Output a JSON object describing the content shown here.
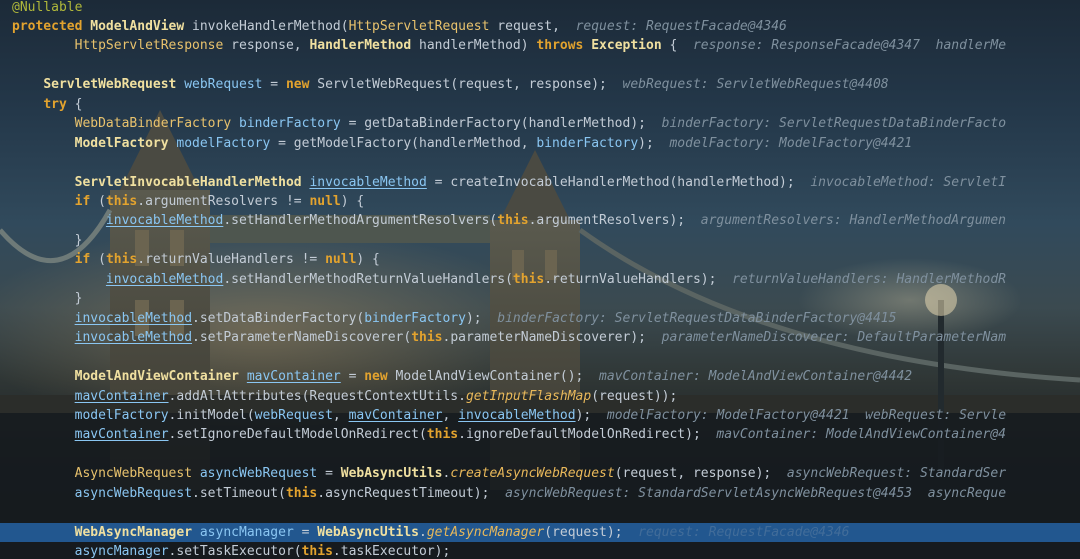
{
  "colors": {
    "keyword": "#e3a32e",
    "annotation": "#b0b83a",
    "type": "#e8c26d",
    "method": "#f7c66b",
    "variable": "#8ac6f2",
    "field": "#d6a4e8",
    "hint": "#7f909e",
    "current_line": "#22578f"
  },
  "code_lines": [
    {
      "tokens": [
        {
          "t": "@Nullable",
          "c": "an"
        }
      ]
    },
    {
      "tokens": [
        {
          "t": "protected ",
          "c": "kw"
        },
        {
          "t": "ModelAndView",
          "c": "tyb"
        },
        {
          "t": " invokeHandlerMethod(",
          "c": "pl"
        },
        {
          "t": "HttpServletRequest",
          "c": "ty"
        },
        {
          "t": " request,  ",
          "c": "pl"
        },
        {
          "t": "request: RequestFacade@4346",
          "c": "hint"
        }
      ]
    },
    {
      "tokens": [
        {
          "t": "        ",
          "c": "pl"
        },
        {
          "t": "HttpServletResponse",
          "c": "ty"
        },
        {
          "t": " response, ",
          "c": "pl"
        },
        {
          "t": "HandlerMethod",
          "c": "tyb"
        },
        {
          "t": " handlerMethod) ",
          "c": "pl"
        },
        {
          "t": "throws ",
          "c": "kw"
        },
        {
          "t": "Exception",
          "c": "tyb"
        },
        {
          "t": " {  ",
          "c": "pl"
        },
        {
          "t": "response: ResponseFacade@4347  handlerMe",
          "c": "hint"
        }
      ]
    },
    {
      "tokens": []
    },
    {
      "tokens": [
        {
          "t": "    ",
          "c": "pl"
        },
        {
          "t": "ServletWebRequest",
          "c": "tyb"
        },
        {
          "t": " ",
          "c": "pl"
        },
        {
          "t": "webRequest",
          "c": "lv"
        },
        {
          "t": " = ",
          "c": "pl"
        },
        {
          "t": "new ",
          "c": "kw"
        },
        {
          "t": "ServletWebRequest(request, response);  ",
          "c": "pl"
        },
        {
          "t": "webRequest: ServletWebRequest@4408",
          "c": "hint"
        }
      ]
    },
    {
      "tokens": [
        {
          "t": "    ",
          "c": "pl"
        },
        {
          "t": "try",
          "c": "kw"
        },
        {
          "t": " {",
          "c": "pl"
        }
      ]
    },
    {
      "tokens": [
        {
          "t": "        ",
          "c": "pl"
        },
        {
          "t": "WebDataBinderFactory",
          "c": "ty"
        },
        {
          "t": " ",
          "c": "pl"
        },
        {
          "t": "binderFactory",
          "c": "lv"
        },
        {
          "t": " = getDataBinderFactory(handlerMethod);  ",
          "c": "pl"
        },
        {
          "t": "binderFactory: ServletRequestDataBinderFacto",
          "c": "hint"
        }
      ]
    },
    {
      "tokens": [
        {
          "t": "        ",
          "c": "pl"
        },
        {
          "t": "ModelFactory",
          "c": "tyb"
        },
        {
          "t": " ",
          "c": "pl"
        },
        {
          "t": "modelFactory",
          "c": "lv"
        },
        {
          "t": " = getModelFactory(handlerMethod, ",
          "c": "pl"
        },
        {
          "t": "binderFactory",
          "c": "lv"
        },
        {
          "t": ");  ",
          "c": "pl"
        },
        {
          "t": "modelFactory: ModelFactory@4421",
          "c": "hint"
        }
      ]
    },
    {
      "tokens": []
    },
    {
      "tokens": [
        {
          "t": "        ",
          "c": "pl"
        },
        {
          "t": "ServletInvocableHandlerMethod",
          "c": "tyb"
        },
        {
          "t": " ",
          "c": "pl"
        },
        {
          "t": "invocableMethod",
          "c": "lvu"
        },
        {
          "t": " = createInvocableHandlerMethod(handlerMethod);  ",
          "c": "pl"
        },
        {
          "t": "invocableMethod: ServletI",
          "c": "hint"
        }
      ]
    },
    {
      "tokens": [
        {
          "t": "        ",
          "c": "pl"
        },
        {
          "t": "if",
          "c": "kw"
        },
        {
          "t": " (",
          "c": "pl"
        },
        {
          "t": "this",
          "c": "kw"
        },
        {
          "t": ".argumentResolvers != ",
          "c": "pl"
        },
        {
          "t": "null",
          "c": "kw"
        },
        {
          "t": ") {",
          "c": "pl"
        }
      ]
    },
    {
      "tokens": [
        {
          "t": "            ",
          "c": "pl"
        },
        {
          "t": "invocableMethod",
          "c": "lvu"
        },
        {
          "t": ".setHandlerMethodArgumentResolvers(",
          "c": "pl"
        },
        {
          "t": "this",
          "c": "kw"
        },
        {
          "t": ".argumentResolvers);  ",
          "c": "pl"
        },
        {
          "t": "argumentResolvers: HandlerMethodArgumen",
          "c": "hint"
        }
      ]
    },
    {
      "tokens": [
        {
          "t": "        }",
          "c": "pl"
        }
      ]
    },
    {
      "tokens": [
        {
          "t": "        ",
          "c": "pl"
        },
        {
          "t": "if",
          "c": "kw"
        },
        {
          "t": " (",
          "c": "pl"
        },
        {
          "t": "this",
          "c": "kw"
        },
        {
          "t": ".returnValueHandlers != ",
          "c": "pl"
        },
        {
          "t": "null",
          "c": "kw"
        },
        {
          "t": ") {",
          "c": "pl"
        }
      ]
    },
    {
      "tokens": [
        {
          "t": "            ",
          "c": "pl"
        },
        {
          "t": "invocableMethod",
          "c": "lvu"
        },
        {
          "t": ".setHandlerMethodReturnValueHandlers(",
          "c": "pl"
        },
        {
          "t": "this",
          "c": "kw"
        },
        {
          "t": ".returnValueHandlers);  ",
          "c": "pl"
        },
        {
          "t": "returnValueHandlers: HandlerMethodR",
          "c": "hint"
        }
      ]
    },
    {
      "tokens": [
        {
          "t": "        }",
          "c": "pl"
        }
      ]
    },
    {
      "tokens": [
        {
          "t": "        ",
          "c": "pl"
        },
        {
          "t": "invocableMethod",
          "c": "lvu"
        },
        {
          "t": ".setDataBinderFactory(",
          "c": "pl"
        },
        {
          "t": "binderFactory",
          "c": "lv"
        },
        {
          "t": ");  ",
          "c": "pl"
        },
        {
          "t": "binderFactory: ServletRequestDataBinderFactory@4415",
          "c": "hint"
        }
      ]
    },
    {
      "tokens": [
        {
          "t": "        ",
          "c": "pl"
        },
        {
          "t": "invocableMethod",
          "c": "lvu"
        },
        {
          "t": ".setParameterNameDiscoverer(",
          "c": "pl"
        },
        {
          "t": "this",
          "c": "kw"
        },
        {
          "t": ".parameterNameDiscoverer);  ",
          "c": "pl"
        },
        {
          "t": "parameterNameDiscoverer: DefaultParameterNam",
          "c": "hint"
        }
      ]
    },
    {
      "tokens": []
    },
    {
      "tokens": [
        {
          "t": "        ",
          "c": "pl"
        },
        {
          "t": "ModelAndViewContainer",
          "c": "tyb"
        },
        {
          "t": " ",
          "c": "pl"
        },
        {
          "t": "mavContainer",
          "c": "lvu"
        },
        {
          "t": " = ",
          "c": "pl"
        },
        {
          "t": "new ",
          "c": "kw"
        },
        {
          "t": "ModelAndViewContainer();  ",
          "c": "pl"
        },
        {
          "t": "mavContainer: ModelAndViewContainer@4442",
          "c": "hint"
        }
      ]
    },
    {
      "tokens": [
        {
          "t": "        ",
          "c": "pl"
        },
        {
          "t": "mavContainer",
          "c": "lvu"
        },
        {
          "t": ".addAllAttributes(RequestContextUtils.",
          "c": "pl"
        },
        {
          "t": "getInputFlashMap",
          "c": "st"
        },
        {
          "t": "(request));",
          "c": "pl"
        }
      ]
    },
    {
      "tokens": [
        {
          "t": "        ",
          "c": "pl"
        },
        {
          "t": "modelFactory",
          "c": "lv"
        },
        {
          "t": ".initModel(",
          "c": "pl"
        },
        {
          "t": "webRequest",
          "c": "lv"
        },
        {
          "t": ", ",
          "c": "pl"
        },
        {
          "t": "mavContainer",
          "c": "lvu"
        },
        {
          "t": ", ",
          "c": "pl"
        },
        {
          "t": "invocableMethod",
          "c": "lvu"
        },
        {
          "t": ");  ",
          "c": "pl"
        },
        {
          "t": "modelFactory: ModelFactory@4421  webRequest: Servle",
          "c": "hint"
        }
      ]
    },
    {
      "tokens": [
        {
          "t": "        ",
          "c": "pl"
        },
        {
          "t": "mavContainer",
          "c": "lvu"
        },
        {
          "t": ".setIgnoreDefaultModelOnRedirect(",
          "c": "pl"
        },
        {
          "t": "this",
          "c": "kw"
        },
        {
          "t": ".ignoreDefaultModelOnRedirect);  ",
          "c": "pl"
        },
        {
          "t": "mavContainer: ModelAndViewContainer@4",
          "c": "hint"
        }
      ]
    },
    {
      "tokens": []
    },
    {
      "tokens": [
        {
          "t": "        ",
          "c": "pl"
        },
        {
          "t": "AsyncWebRequest",
          "c": "ty"
        },
        {
          "t": " ",
          "c": "pl"
        },
        {
          "t": "asyncWebRequest",
          "c": "lv"
        },
        {
          "t": " = ",
          "c": "pl"
        },
        {
          "t": "WebAsyncUtils",
          "c": "tyb"
        },
        {
          "t": ".",
          "c": "pl"
        },
        {
          "t": "createAsyncWebRequest",
          "c": "st"
        },
        {
          "t": "(request, response);  ",
          "c": "pl"
        },
        {
          "t": "asyncWebRequest: StandardSer",
          "c": "hint"
        }
      ]
    },
    {
      "tokens": [
        {
          "t": "        ",
          "c": "pl"
        },
        {
          "t": "asyncWebRequest",
          "c": "lv"
        },
        {
          "t": ".setTimeout(",
          "c": "pl"
        },
        {
          "t": "this",
          "c": "kw"
        },
        {
          "t": ".asyncRequestTimeout);  ",
          "c": "pl"
        },
        {
          "t": "asyncWebRequest: StandardServletAsyncWebRequest@4453  asyncReque",
          "c": "hint"
        }
      ]
    },
    {
      "tokens": []
    },
    {
      "tokens": [
        {
          "t": "        ",
          "c": "pl"
        },
        {
          "t": "WebAsyncManager",
          "c": "tyb"
        },
        {
          "t": " ",
          "c": "pl"
        },
        {
          "t": "asyncManager",
          "c": "lv"
        },
        {
          "t": " = ",
          "c": "pl"
        },
        {
          "t": "WebAsyncUtils",
          "c": "tyb"
        },
        {
          "t": ".",
          "c": "pl"
        },
        {
          "t": "getAsyncManager",
          "c": "st"
        },
        {
          "t": "(request);  ",
          "c": "pl"
        },
        {
          "t": "request: RequestFacade@4346",
          "c": "hint"
        }
      ]
    },
    {
      "tokens": [
        {
          "t": "        ",
          "c": "pl"
        },
        {
          "t": "asyncManager",
          "c": "lv"
        },
        {
          "t": ".setTaskExecutor(",
          "c": "pl"
        },
        {
          "t": "this",
          "c": "kw"
        },
        {
          "t": ".taskExecutor);",
          "c": "pl"
        }
      ]
    }
  ]
}
